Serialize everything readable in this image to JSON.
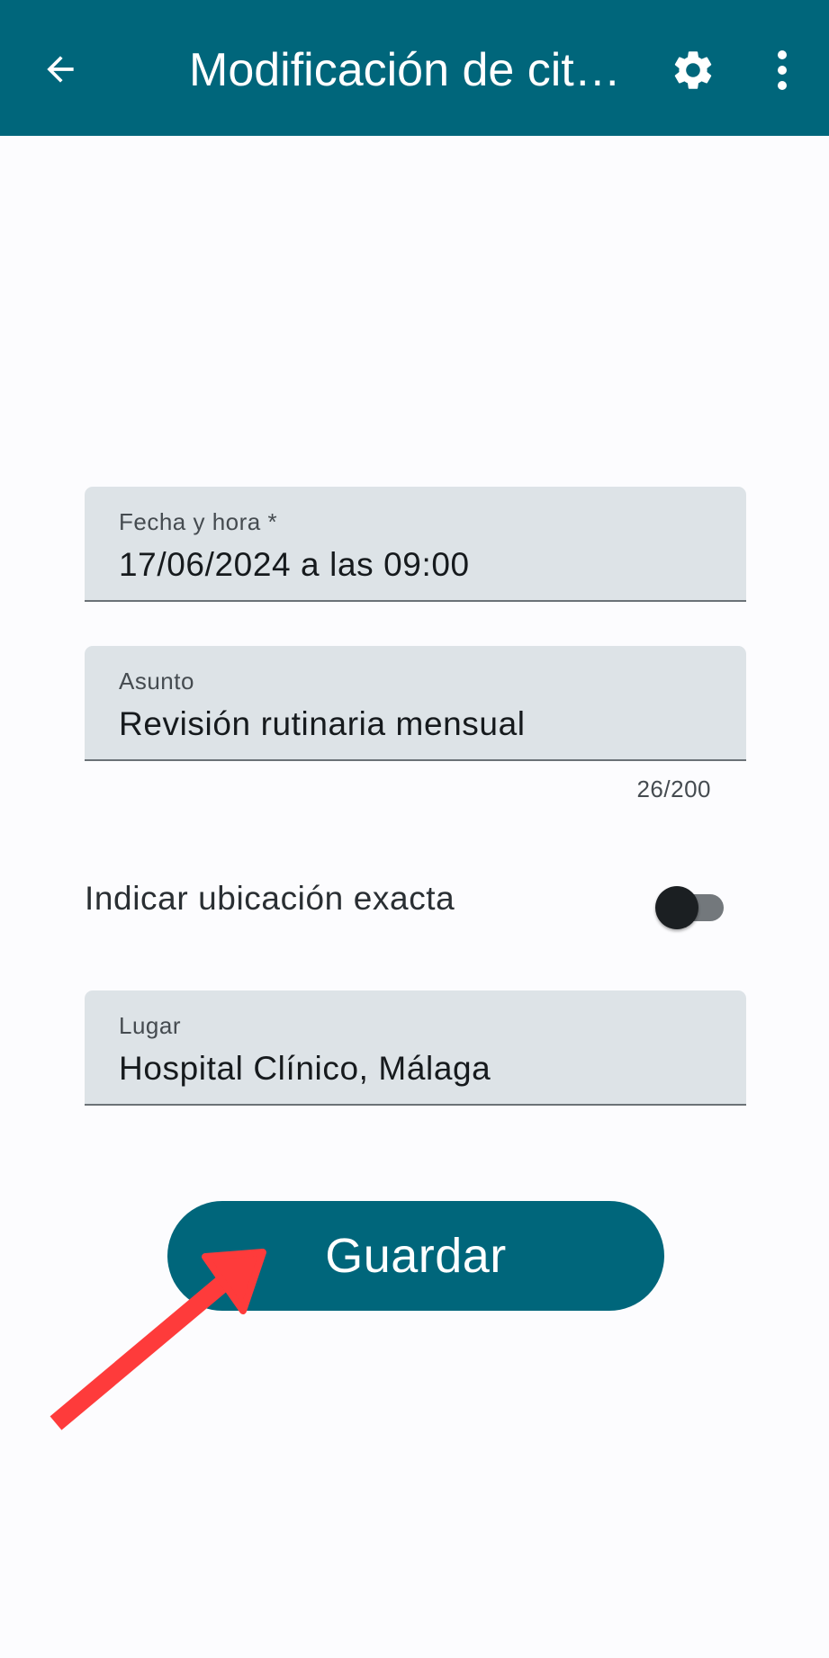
{
  "appbar": {
    "title": "Modificación de cita…",
    "back_icon": "arrow-back-icon",
    "settings_icon": "gear-icon",
    "more_icon": "more-vert-icon",
    "background_color": "#00667b"
  },
  "form": {
    "datetime": {
      "label": "Fecha y hora *",
      "value": "17/06/2024 a las 09:00"
    },
    "subject": {
      "label": "Asunto",
      "value": "Revisión rutinaria mensual",
      "counter": "26/200"
    },
    "exact_location": {
      "label": "Indicar ubicación exacta",
      "checked": false
    },
    "place": {
      "label": "Lugar",
      "value": "Hospital Clínico, Málaga"
    }
  },
  "actions": {
    "save_label": "Guardar"
  },
  "annotation": {
    "type": "arrow",
    "color": "#fe3b3b",
    "points_to": "save-button"
  }
}
